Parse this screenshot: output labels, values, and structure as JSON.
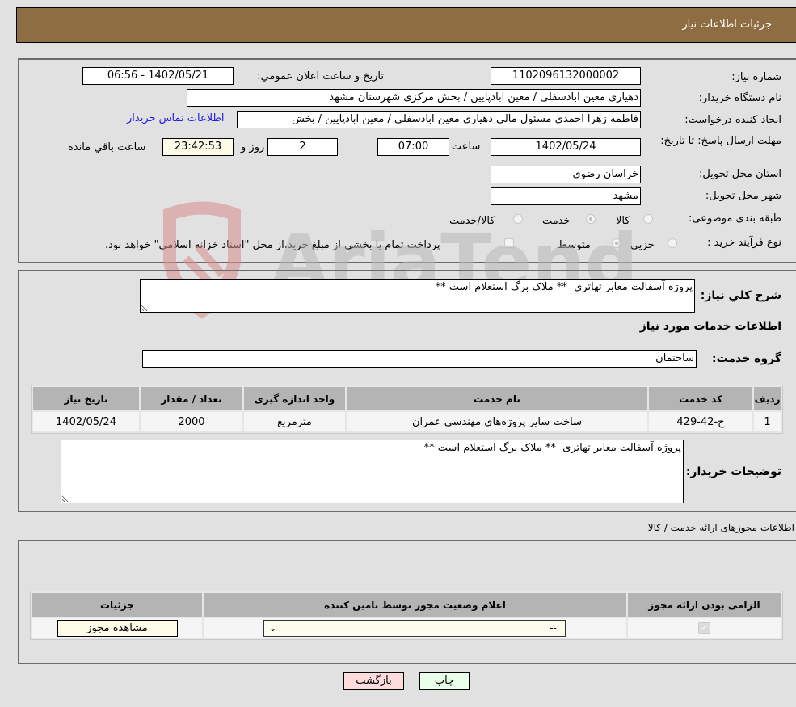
{
  "header": {
    "title": "جزئیات اطلاعات نیاز"
  },
  "form": {
    "need_number_label": "شماره نیاز:",
    "need_number": "1102096132000002",
    "announce_label": "تاریخ و ساعت اعلان عمومي:",
    "announce_value": "1402/05/21 - 06:56",
    "buyer_org_label": "نام دستگاه خریدار:",
    "buyer_org": "دهیاری معین ابادسفلی / معین ابادپایین / بخش مرکزی شهرستان مشهد",
    "creator_label": "ایجاد کننده درخواست:",
    "creator": "فاطمه زهرا احمدی مسئول مالی دهیاری معین ابادسفلی / معین ابادپایین / بخش",
    "contact_link": "اطلاعات تماس خریدار",
    "deadline_label": "مهلت ارسال پاسخ: تا تاریخ:",
    "deadline_date": "1402/05/24",
    "time_label": "ساعت",
    "deadline_time": "07:00",
    "days_value": "2",
    "days_label": "روز و",
    "remaining_time": "23:42:53",
    "remaining_label": "ساعت باقي مانده",
    "province_label": "استان محل تحویل:",
    "province": "خراسان رضوی",
    "city_label": "شهر محل تحویل:",
    "city": "مشهد",
    "category_label": "طبقه بندی موضوعی:",
    "category_options": [
      {
        "label": "کالا",
        "checked": false
      },
      {
        "label": "خدمت",
        "checked": true
      },
      {
        "label": "کالا/خدمت",
        "checked": false
      }
    ],
    "process_label": "نوع فرآیند خرید :",
    "process_options": [
      {
        "label": "جزيي",
        "checked": false
      },
      {
        "label": "متوسط",
        "checked": true
      }
    ],
    "treasury_note": "پرداخت تمام یا بخشی از مبلغ خرید،از محل \"اسناد خزانه اسلامی\" خواهد بود.",
    "treasury_checked": false
  },
  "description": {
    "label": "شرح کلي نیاز:",
    "value": "پروژه آسفالت معابر تهاتری  ** ملاک برگ استعلام است **"
  },
  "services": {
    "section_title": "اطلاعات خدمات مورد نیاز",
    "group_label": "گروه خدمت:",
    "group_value": "ساختمان",
    "columns": [
      "ردیف",
      "کد خدمت",
      "نام خدمت",
      "واحد اندازه گیری",
      "تعداد / مقدار",
      "تاریخ نیاز"
    ],
    "rows": [
      {
        "row": "1",
        "code": "ج-42-429",
        "name": "ساخت سایر پروژه‌های مهندسی عمران",
        "unit": "مترمربع",
        "qty": "2000",
        "date": "1402/05/24"
      }
    ],
    "buyer_notes_label": "توضیحات خریدار:",
    "buyer_notes": "پروژه آسفالت معابر تهاتری  ** ملاک برگ استعلام است **"
  },
  "permits": {
    "section_title": "اطلاعات مجوزهای ارائه خدمت / کالا",
    "columns": [
      "الزامی بودن ارائه مجوز",
      "اعلام وضعیت مجوز توسط تامین کننده",
      "جزئیات"
    ],
    "rows": [
      {
        "required": true,
        "status": "--",
        "details_button": "مشاهده مجوز"
      }
    ]
  },
  "actions": {
    "print": "چاپ",
    "back": "بازگشت"
  },
  "watermark": {
    "text": "AriaTender.neT"
  },
  "colors": {
    "header_bg": "#8f6d42",
    "print_bg": "#eaffea",
    "back_bg": "#ffdcdc",
    "link": "#1a1aee"
  }
}
